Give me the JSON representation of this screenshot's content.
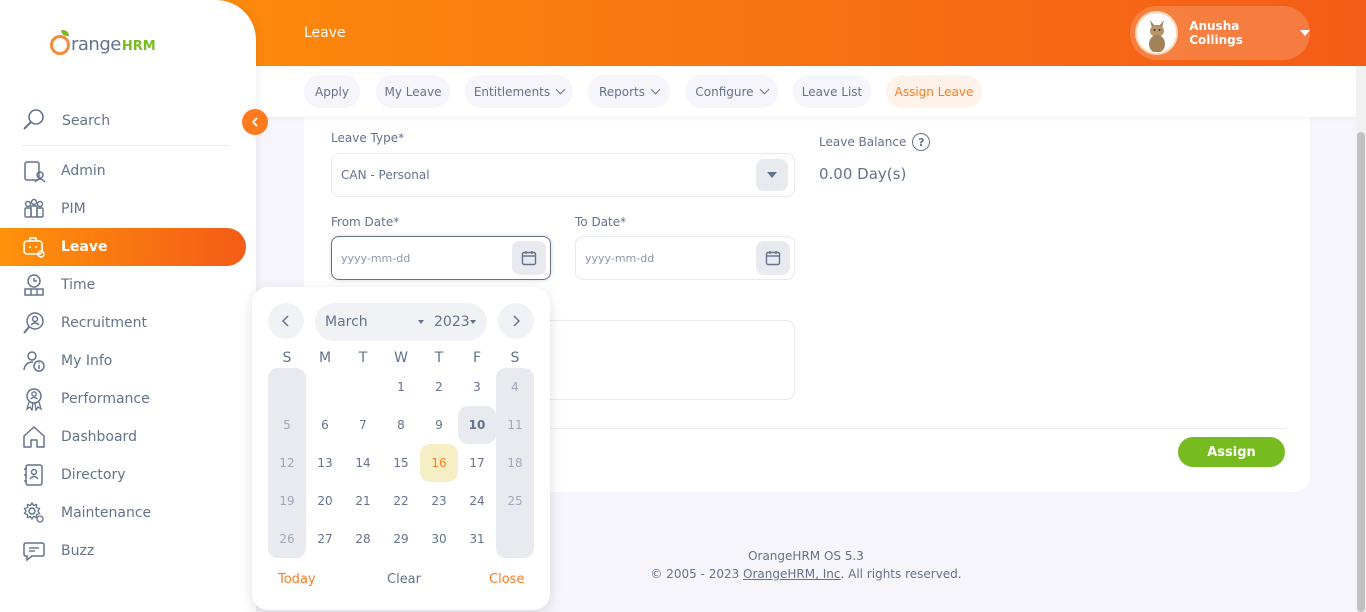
{
  "brand": {
    "logo_main": "range",
    "logo_suffix": "HRM",
    "accent": "#ff7b1d",
    "green": "#76bc21"
  },
  "header": {
    "title": "Leave",
    "user_name": "Anusha Collings"
  },
  "sidebar": {
    "search_label": "Search",
    "items": [
      {
        "label": "Admin",
        "icon": "admin-icon"
      },
      {
        "label": "PIM",
        "icon": "pim-icon"
      },
      {
        "label": "Leave",
        "icon": "leave-icon",
        "active": true
      },
      {
        "label": "Time",
        "icon": "time-icon"
      },
      {
        "label": "Recruitment",
        "icon": "recruitment-icon"
      },
      {
        "label": "My Info",
        "icon": "my-info-icon"
      },
      {
        "label": "Performance",
        "icon": "performance-icon"
      },
      {
        "label": "Dashboard",
        "icon": "dashboard-icon"
      },
      {
        "label": "Directory",
        "icon": "directory-icon"
      },
      {
        "label": "Maintenance",
        "icon": "maintenance-icon"
      },
      {
        "label": "Buzz",
        "icon": "buzz-icon"
      }
    ]
  },
  "topnav": {
    "tabs": [
      {
        "label": "Apply"
      },
      {
        "label": "My Leave"
      },
      {
        "label": "Entitlements",
        "dropdown": true
      },
      {
        "label": "Reports",
        "dropdown": true
      },
      {
        "label": "Configure",
        "dropdown": true
      },
      {
        "label": "Leave List"
      },
      {
        "label": "Assign Leave",
        "active": true
      }
    ]
  },
  "form": {
    "leave_type_label": "Leave Type*",
    "leave_type_value": "CAN - Personal",
    "leave_balance_label": "Leave Balance",
    "leave_balance_value": "0.00 Day(s)",
    "help_glyph": "?",
    "from_date_label": "From Date*",
    "from_date_placeholder": "yyyy-mm-dd",
    "to_date_label": "To Date*",
    "to_date_placeholder": "yyyy-mm-dd",
    "assign_label": "Assign"
  },
  "datepicker": {
    "month": "March",
    "year": "2023",
    "weekdays": [
      "S",
      "M",
      "T",
      "W",
      "T",
      "F",
      "S"
    ],
    "first_weekday_index": 3,
    "days_in_month": 31,
    "selected_day": 10,
    "today_day": 16,
    "today_label": "Today",
    "clear_label": "Clear",
    "close_label": "Close"
  },
  "footer": {
    "version": "OrangeHRM OS 5.3",
    "copyright_prefix": "© 2005 - 2023 ",
    "company_link": "OrangeHRM, Inc",
    "copyright_suffix": ". All rights reserved."
  }
}
